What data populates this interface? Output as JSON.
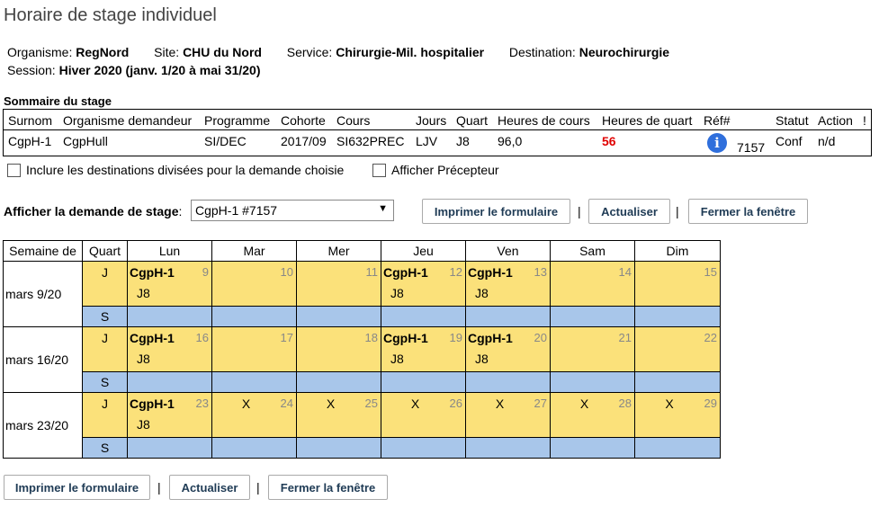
{
  "page": {
    "title": "Horaire de stage individuel"
  },
  "header": {
    "organisme_label": "Organisme:",
    "organisme": "RegNord",
    "site_label": "Site:",
    "site": "CHU du Nord",
    "service_label": "Service:",
    "service": "Chirurgie-Mil. hospitalier",
    "destination_label": "Destination:",
    "destination": "Neurochirurgie",
    "session_label": "Session:",
    "session": "Hiver 2020 (janv. 1/20 à mai 31/20)"
  },
  "summary": {
    "title": "Sommaire du stage",
    "headers": [
      "Surnom",
      "Organisme demandeur",
      "Programme",
      "Cohorte",
      "Cours",
      "Jours",
      "Quart",
      "Heures de cours",
      "Heures de quart",
      "Réf#",
      "Statut",
      "Action",
      "!"
    ],
    "row": {
      "surnom": "CgpH-1",
      "organisme": "CgpHull",
      "programme": "SI/DEC",
      "cohorte": "2017/09",
      "cours": "SI632PREC",
      "jours": "LJV",
      "quart": "J8",
      "heures_cours": "96,0",
      "heures_quart": "56",
      "ref": "7157",
      "statut": "Conf",
      "action": "n/d"
    }
  },
  "options": {
    "inclure_label": "Inclure les destinations divisées pour la demande choisie",
    "precepteur_label": "Afficher Précepteur"
  },
  "demande": {
    "label": "Afficher la demande de stage",
    "colon": ":",
    "selected": "CgpH-1 #7157"
  },
  "buttons": {
    "imprimer": "Imprimer le formulaire",
    "actualiser": "Actualiser",
    "fermer": "Fermer la fenêtre",
    "sep": "|"
  },
  "calendar": {
    "headers": [
      "Semaine de",
      "Quart",
      "Lun",
      "Mar",
      "Mer",
      "Jeu",
      "Ven",
      "Sam",
      "Dim"
    ],
    "shift_j": "J",
    "shift_s": "S",
    "weeks": [
      {
        "label": "mars 9/20",
        "days": [
          {
            "num": "9",
            "code": "CgpH-1",
            "shift": "J8",
            "mark": ""
          },
          {
            "num": "10",
            "code": "",
            "shift": "",
            "mark": ""
          },
          {
            "num": "11",
            "code": "",
            "shift": "",
            "mark": ""
          },
          {
            "num": "12",
            "code": "CgpH-1",
            "shift": "J8",
            "mark": ""
          },
          {
            "num": "13",
            "code": "CgpH-1",
            "shift": "J8",
            "mark": ""
          },
          {
            "num": "14",
            "code": "",
            "shift": "",
            "mark": ""
          },
          {
            "num": "15",
            "code": "",
            "shift": "",
            "mark": ""
          }
        ]
      },
      {
        "label": "mars 16/20",
        "days": [
          {
            "num": "16",
            "code": "CgpH-1",
            "shift": "J8",
            "mark": ""
          },
          {
            "num": "17",
            "code": "",
            "shift": "",
            "mark": ""
          },
          {
            "num": "18",
            "code": "",
            "shift": "",
            "mark": ""
          },
          {
            "num": "19",
            "code": "CgpH-1",
            "shift": "J8",
            "mark": ""
          },
          {
            "num": "20",
            "code": "CgpH-1",
            "shift": "J8",
            "mark": ""
          },
          {
            "num": "21",
            "code": "",
            "shift": "",
            "mark": ""
          },
          {
            "num": "22",
            "code": "",
            "shift": "",
            "mark": ""
          }
        ]
      },
      {
        "label": "mars 23/20",
        "days": [
          {
            "num": "23",
            "code": "CgpH-1",
            "shift": "J8",
            "mark": ""
          },
          {
            "num": "24",
            "code": "",
            "shift": "",
            "mark": "X"
          },
          {
            "num": "25",
            "code": "",
            "shift": "",
            "mark": "X"
          },
          {
            "num": "26",
            "code": "",
            "shift": "",
            "mark": "X"
          },
          {
            "num": "27",
            "code": "",
            "shift": "",
            "mark": "X"
          },
          {
            "num": "28",
            "code": "",
            "shift": "",
            "mark": "X"
          },
          {
            "num": "29",
            "code": "",
            "shift": "",
            "mark": "X"
          }
        ]
      }
    ]
  },
  "colors": {
    "day_shift": "#fbe17a",
    "night_shift": "#a8c6ea",
    "accent_red": "#e00000",
    "info_blue": "#2f6fdc"
  }
}
